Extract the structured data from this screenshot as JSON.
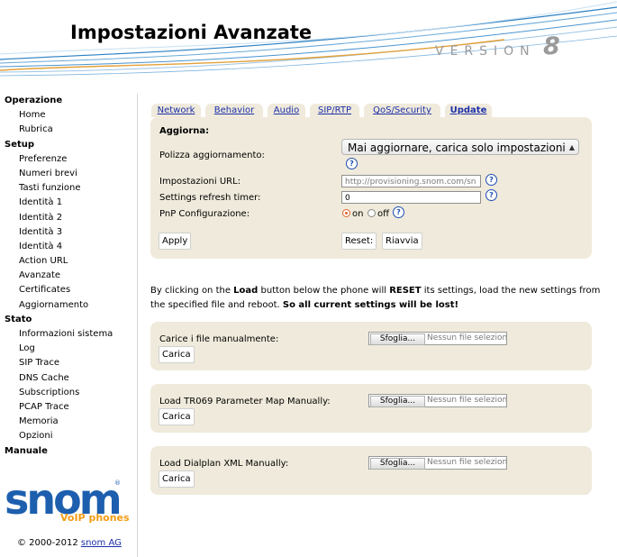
{
  "header": {
    "title": "Impostazioni Avanzate",
    "version_label": "VERSION",
    "version_number": "8"
  },
  "sidebar": {
    "groups": [
      {
        "label": "Operazione",
        "items": [
          "Home",
          "Rubrica"
        ]
      },
      {
        "label": "Setup",
        "items": [
          "Preferenze",
          "Numeri brevi",
          "Tasti funzione",
          "Identità 1",
          "Identità 2",
          "Identità 3",
          "Identità 4",
          "Action URL",
          "Avanzate",
          "Certificates",
          "Aggiornamento"
        ]
      },
      {
        "label": "Stato",
        "items": [
          "Informazioni sistema",
          "Log",
          "SIP Trace",
          "DNS Cache",
          "Subscriptions",
          "PCAP Trace",
          "Memoria",
          "Opzioni"
        ]
      },
      {
        "label": "Manuale",
        "items": []
      }
    ]
  },
  "logo": {
    "text": "snom",
    "sub": "VoIP phones",
    "reg": "®"
  },
  "footer": {
    "copyright": "© 2000-2012",
    "link": "snom AG"
  },
  "tabs": [
    "Network",
    "Behavior",
    "Audio",
    "SIP/RTP",
    "QoS/Security",
    "Update"
  ],
  "update": {
    "section_title": "Aggiorna:",
    "policy_label": "Polizza aggiornamento:",
    "policy_value": "Mai aggiornare, carica solo impostazioni",
    "url_label": "Impostazioni URL:",
    "url_value": "http://provisioning.snom.com/sn",
    "refresh_label": "Settings refresh timer:",
    "refresh_value": "0",
    "pnp_label": "PnP Configurazione:",
    "pnp_on": "on",
    "pnp_off": "off",
    "apply": "Apply",
    "reset": "Reset:",
    "restart": "Riavvia"
  },
  "warning": {
    "p1": "By clicking on the ",
    "load": "Load",
    "p2": " button below the phone will ",
    "reset": "RESET",
    "p3": " its settings, load the new settings from the specified file and reboot. ",
    "bold": "So all current settings will be lost!"
  },
  "uploads": [
    {
      "label": "Carice i file manualmente:",
      "browse": "Sfoglia...",
      "nofile": "Nessun file selezionato.",
      "button": "Carica"
    },
    {
      "label": "Load TR069 Parameter Map Manually:",
      "browse": "Sfoglia...",
      "nofile": "Nessun file selezionato.",
      "button": "Carica"
    },
    {
      "label": "Load Dialplan XML Manually:",
      "browse": "Sfoglia...",
      "nofile": "Nessun file selezionato.",
      "button": "Carica"
    }
  ],
  "colors": {
    "panel": "#efeadb",
    "link": "#1d2fa8",
    "logo": "#1d5fae",
    "logo_sub": "#f39c12",
    "help": "#1d4fb0"
  }
}
